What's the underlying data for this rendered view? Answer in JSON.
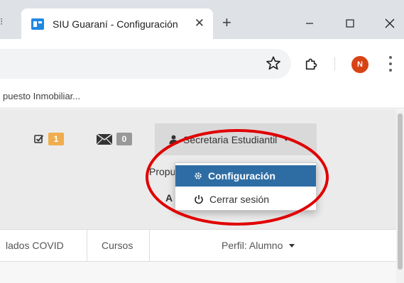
{
  "browser": {
    "tab_title": "SIU Guaraní - Configuración",
    "tab_close_icon": "close-icon",
    "new_tab_icon": "plus-icon",
    "window_controls": [
      "minimize-icon",
      "maximize-icon",
      "close-icon"
    ],
    "profile_initial": "N",
    "bookmark_label": "puesto Inmobiliar..."
  },
  "header": {
    "tasks_badge": "1",
    "messages_badge": "0",
    "user_menu_label": "Secretaria Estudiantil",
    "behind_text_1": "Propu",
    "behind_text_2": "A"
  },
  "dropdown": {
    "items": [
      {
        "label": "Configuración",
        "icon": "gear-icon",
        "active": true
      },
      {
        "label": "Cerrar sesión",
        "icon": "power-icon",
        "active": false
      }
    ]
  },
  "nav": {
    "covid": "lados COVID",
    "cursos": "Cursos",
    "perfil": "Perfil: Alumno"
  },
  "colors": {
    "accent_active": "#2e6da4",
    "badge_orange": "#f0ad4e",
    "badge_gray": "#999999",
    "annotation_red": "#e00000",
    "avatar": "#d84315"
  }
}
